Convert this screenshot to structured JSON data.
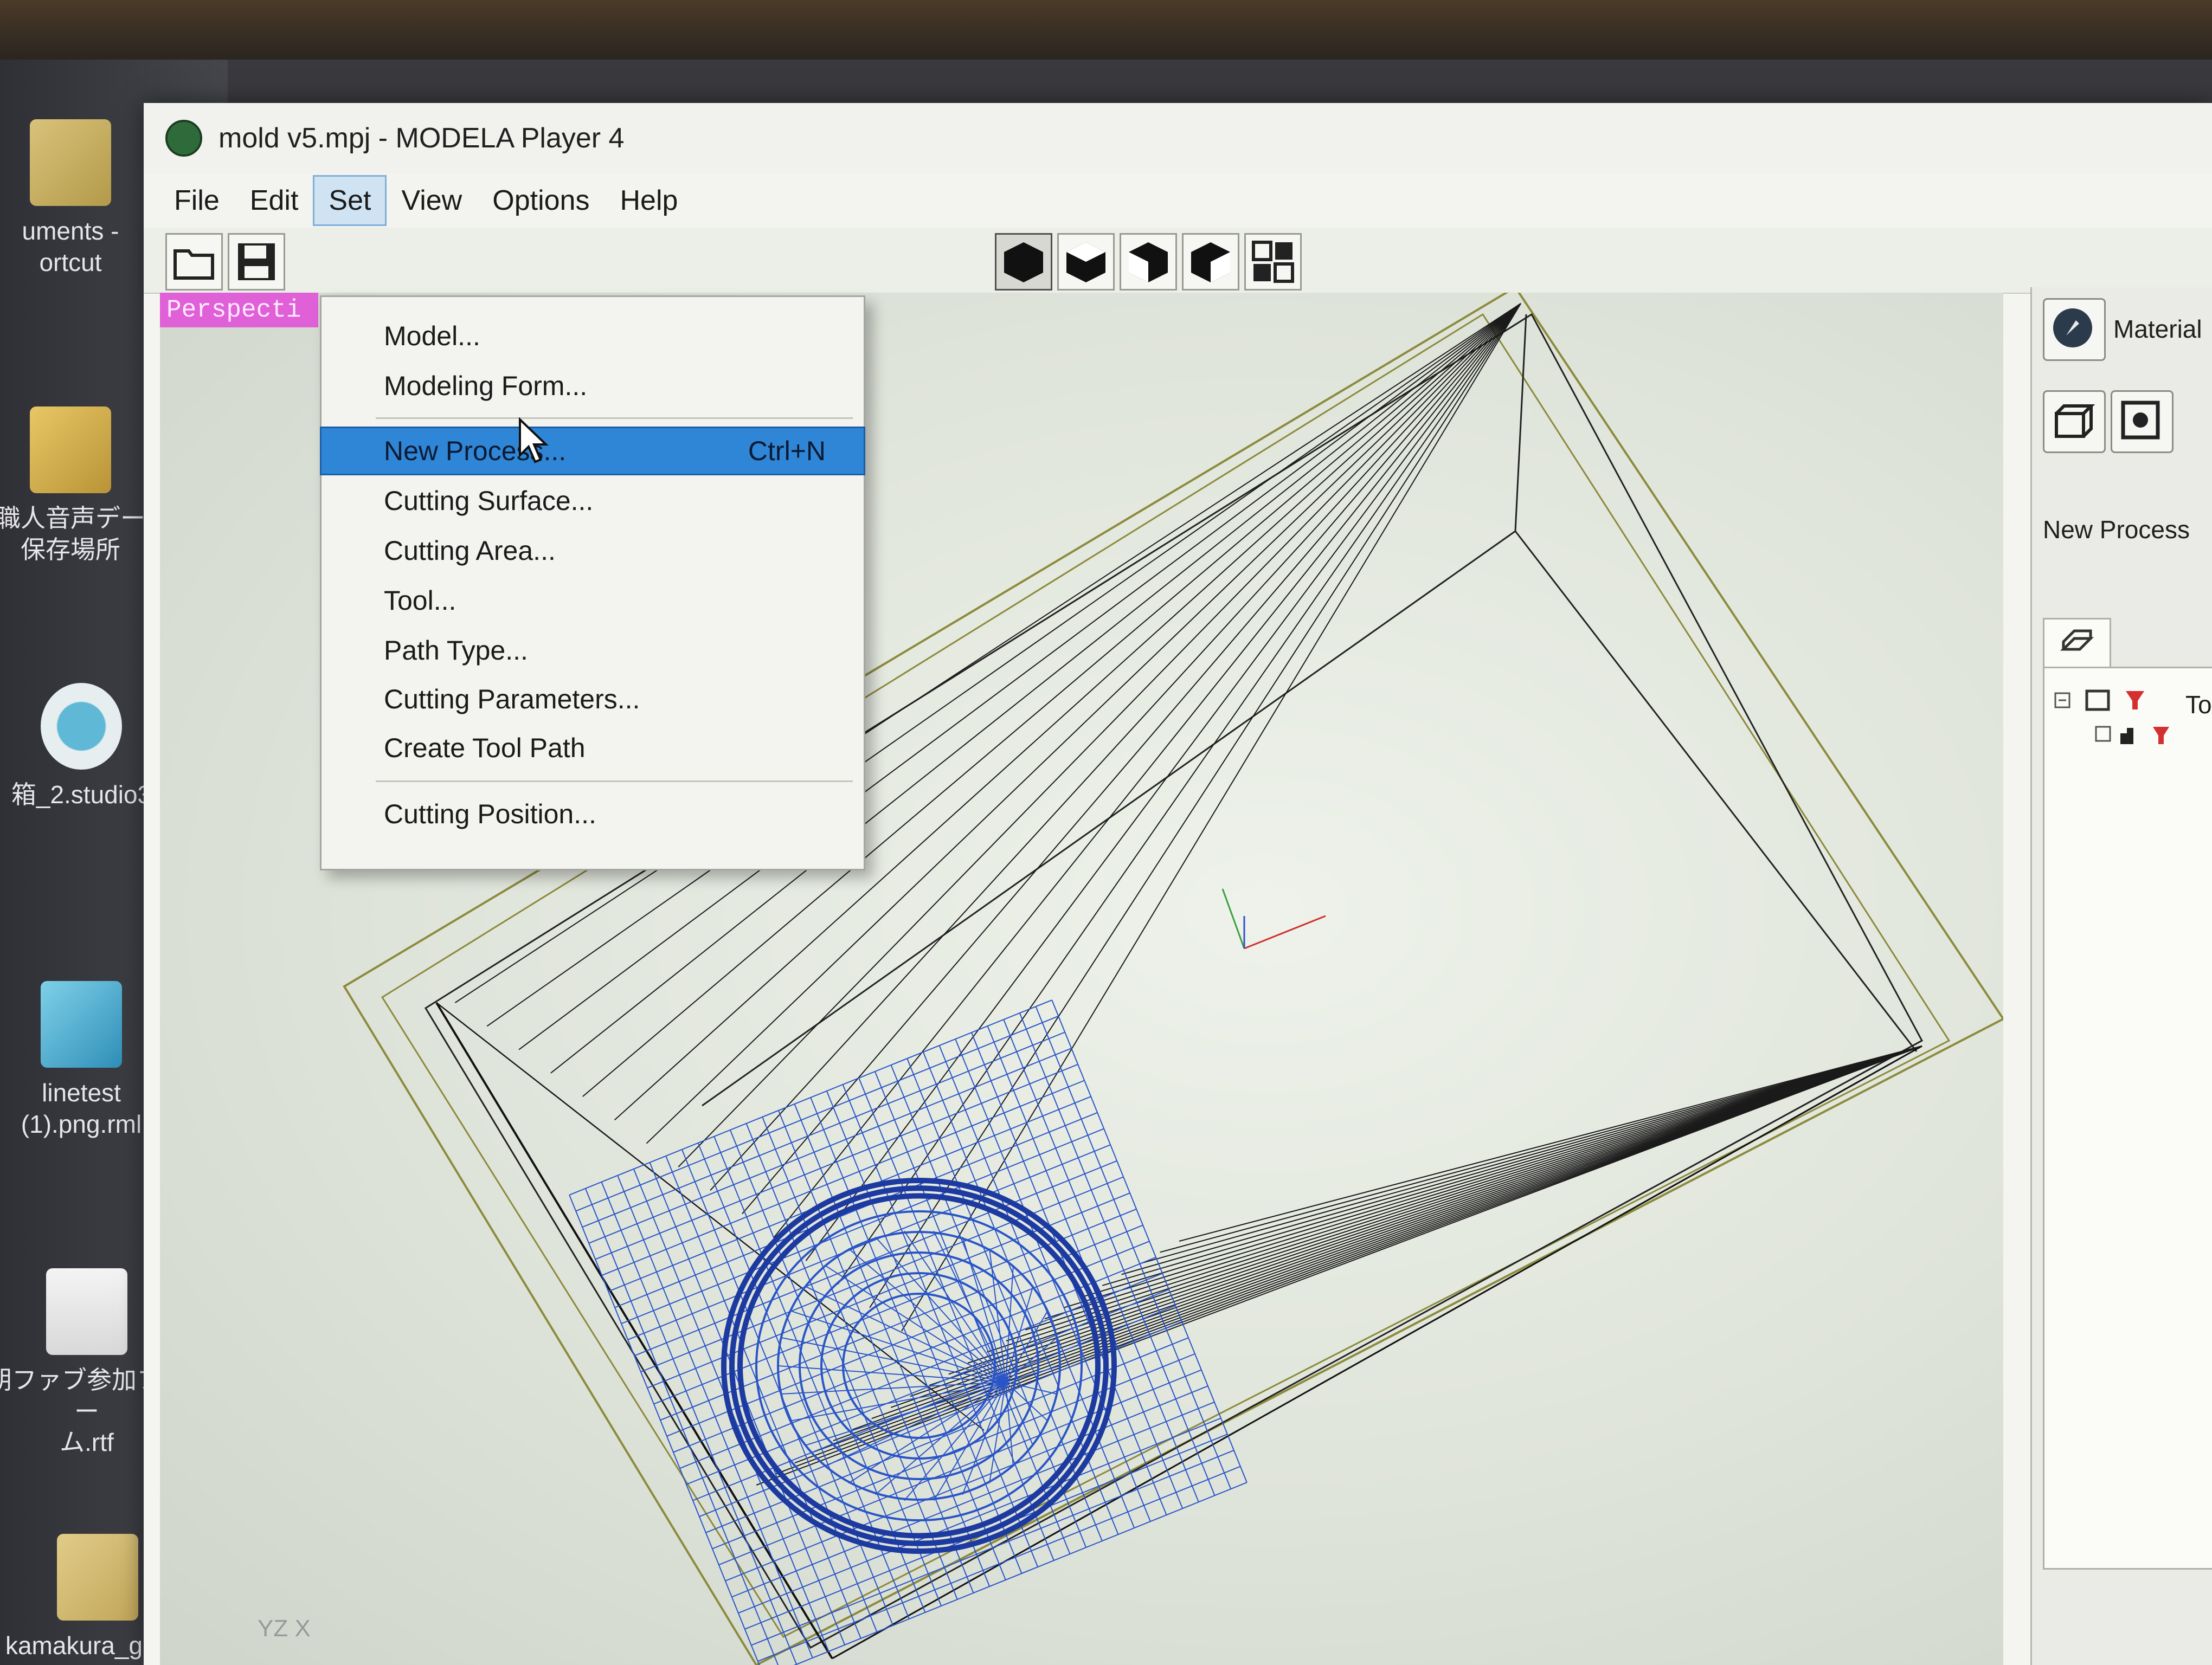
{
  "desktop": {
    "icons": [
      {
        "name": "documents-shortcut-icon",
        "label": "uments -\nortcut"
      },
      {
        "name": "audio-folder-icon",
        "label": "職人音声デー\n保存場所"
      },
      {
        "name": "studio3-file-icon",
        "label": "箱_2.studio3"
      },
      {
        "name": "rml-file-icon",
        "label": "linetest\n(1).png.rml"
      },
      {
        "name": "rtf-file-icon",
        "label": "朝ファブ参加フォー\nム.rtf"
      },
      {
        "name": "guest-shortcut-icon",
        "label": "kamakura_guest"
      }
    ]
  },
  "window": {
    "title": "mold v5.mpj - MODELA Player 4",
    "menu": [
      "File",
      "Edit",
      "Set",
      "View",
      "Options",
      "Help"
    ],
    "active_menu": "Set",
    "viewport_label": "Perspecti",
    "axis_label": "YZ X"
  },
  "toolbar": {
    "icons": [
      "open-folder-icon",
      "save-icon",
      "view-solid-icon",
      "view-front-icon",
      "view-right-icon",
      "view-side-icon",
      "multi-view-icon"
    ]
  },
  "set_menu": {
    "items": [
      {
        "label": "Model...",
        "shortcut": ""
      },
      {
        "label": "Modeling Form...",
        "shortcut": ""
      },
      {
        "label": "New Process...",
        "shortcut": "Ctrl+N",
        "highlighted": true
      },
      {
        "label": "Cutting Surface...",
        "shortcut": ""
      },
      {
        "label": "Cutting Area...",
        "shortcut": ""
      },
      {
        "label": "Tool...",
        "shortcut": ""
      },
      {
        "label": "Path Type...",
        "shortcut": ""
      },
      {
        "label": "Cutting Parameters...",
        "shortcut": ""
      },
      {
        "label": "Create Tool Path",
        "shortcut": ""
      },
      {
        "label": "Cutting Position...",
        "shortcut": ""
      }
    ]
  },
  "panel": {
    "material_label": "Material",
    "new_process_label": "New Process",
    "tree_text": "To"
  },
  "colors": {
    "highlight": "#2f86d6",
    "perspective_label": "#e060d8",
    "toolpath_blue": "#2a55c8"
  }
}
